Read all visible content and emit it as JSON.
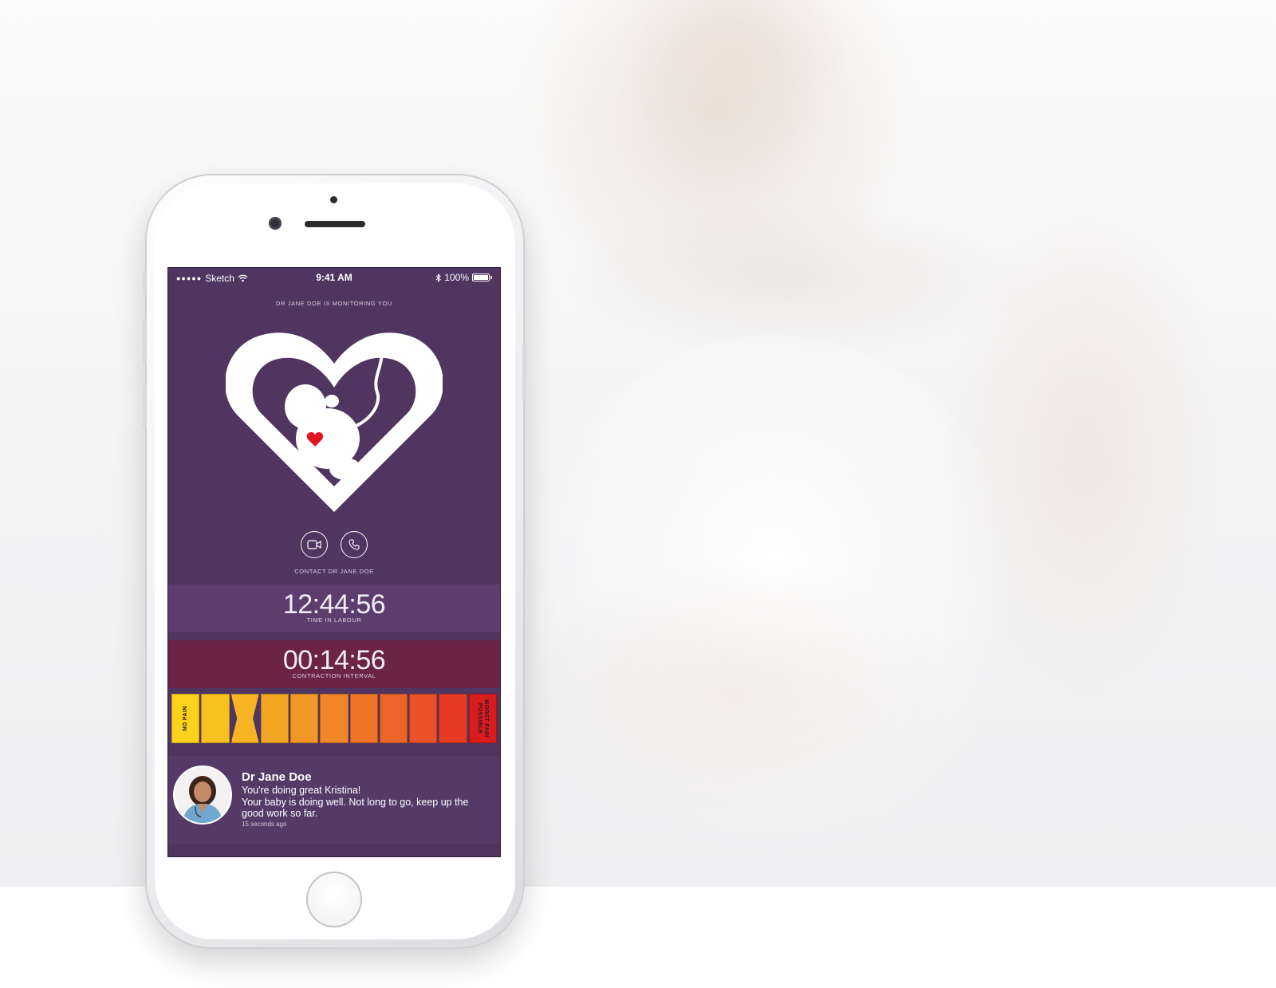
{
  "status_bar": {
    "signal_dots": "●●●●●",
    "carrier": "Sketch",
    "time": "9:41 AM",
    "battery": "100%"
  },
  "monitoring_text": "DR JANE DOE IS MONITORING YOU",
  "contact": {
    "label": "CONTACT DR JANE DOE",
    "video_icon": "video-camera-icon",
    "phone_icon": "phone-icon"
  },
  "time_in_labour": {
    "value": "12:44:56",
    "label": "TIME IN LABOUR"
  },
  "contraction_interval": {
    "value": "00:14:56",
    "label": "CONTRACTION INTERVAL"
  },
  "pain_scale": {
    "low_label": "NO PAIN",
    "high_label": "WORST PAIN POSSIBLE",
    "selected_level": 3,
    "levels": 11,
    "colors": [
      "#fcd21c",
      "#f8c11f",
      "#f6b422",
      "#f3a624",
      "#f29626",
      "#f08628",
      "#ee7428",
      "#ed6428",
      "#ea5126",
      "#e63a22",
      "#d91c1c"
    ]
  },
  "message": {
    "sender": "Dr Jane Doe",
    "line1": "You're doing great Kristina!",
    "line2": "Your baby is doing well. Not long to go, keep up the good work so far.",
    "time_ago": "15 seconds ago"
  },
  "colors": {
    "screen_bg": "#4f3560",
    "labour_band": "#5c3d6e",
    "contraction_band": "#6b2347",
    "heart_accent": "#e0161e"
  }
}
